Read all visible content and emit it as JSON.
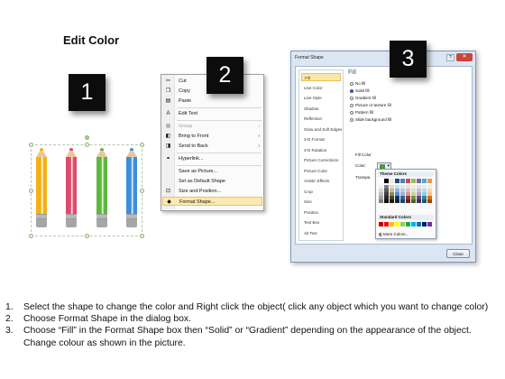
{
  "title": "Edit Color",
  "badges": [
    "1",
    "2",
    "3"
  ],
  "pencils": [
    {
      "name": "yellow",
      "color": "#f2b213"
    },
    {
      "name": "red",
      "color": "#e04a6a"
    },
    {
      "name": "green",
      "color": "#5cb83e"
    },
    {
      "name": "blue",
      "color": "#3a8fdc"
    }
  ],
  "context_menu": {
    "items": [
      {
        "label": "Cut",
        "icon": "scissors-icon",
        "glyph": "✂"
      },
      {
        "label": "Copy",
        "icon": "copy-icon",
        "glyph": "❐"
      },
      {
        "label": "Paste",
        "icon": "paste-icon",
        "glyph": "▤"
      },
      {
        "label": "Edit Text",
        "icon": "edit-text-icon",
        "glyph": "A"
      },
      {
        "label": "Group",
        "icon": "group-icon",
        "glyph": "▦",
        "disabled": true,
        "submenu": true
      },
      {
        "label": "Bring to Front",
        "icon": "bring-front-icon",
        "glyph": "◧",
        "submenu": true
      },
      {
        "label": "Send to Back",
        "icon": "send-back-icon",
        "glyph": "◨",
        "submenu": true
      },
      {
        "label": "Hyperlink...",
        "icon": "hyperlink-icon",
        "glyph": "⚭"
      },
      {
        "label": "Save as Picture...",
        "icon": "",
        "glyph": ""
      },
      {
        "label": "Set as Default Shape",
        "icon": "",
        "glyph": ""
      },
      {
        "label": "Size and Position...",
        "icon": "size-icon",
        "glyph": "⊡"
      },
      {
        "label": "Format Shape...",
        "icon": "format-shape-icon",
        "glyph": "◆",
        "highlight": true
      }
    ]
  },
  "dialog": {
    "title": "Format Shape",
    "close_label": "✕",
    "help_label": "?",
    "nav": [
      "Fill",
      "Line Color",
      "Line Style",
      "Shadow",
      "Reflection",
      "Glow and Soft Edges",
      "3-D Format",
      "3-D Rotation",
      "Picture Corrections",
      "Picture Color",
      "Artistic Effects",
      "Crop",
      "Size",
      "Position",
      "Text Box",
      "Alt Text"
    ],
    "selected_nav": "Fill",
    "pane_heading": "Fill",
    "fill_options": [
      {
        "label": "No fill",
        "checked": false
      },
      {
        "label": "Solid fill",
        "checked": true
      },
      {
        "label": "Gradient fill",
        "checked": false
      },
      {
        "label": "Picture or texture fill",
        "checked": false
      },
      {
        "label": "Pattern fill",
        "checked": false
      },
      {
        "label": "Slide background fill",
        "checked": false
      }
    ],
    "fill_color_label": "Fill Color",
    "color_label": "Color:",
    "transparency_label": "Transpa",
    "theme_colors_label": "Theme Colors",
    "standard_colors_label": "Standard Colors",
    "more_colors_label": "More Colors...",
    "close_button": "Close"
  },
  "palette": {
    "theme_top": [
      "#ffffff",
      "#000000",
      "#eeece1",
      "#1f497d",
      "#4f81bd",
      "#c0504d",
      "#9bbb59",
      "#8064a2",
      "#4bacc6",
      "#f79646"
    ],
    "theme_shades": [
      [
        "#f2f2f2",
        "#7f7f7f",
        "#ddd9c3",
        "#c6d9f0",
        "#dbe5f1",
        "#f2dcdb",
        "#ebf1dd",
        "#e5e0ec",
        "#dbeef3",
        "#fdeada"
      ],
      [
        "#d8d8d8",
        "#595959",
        "#c4bd97",
        "#8db3e2",
        "#b8cce4",
        "#e5b9b7",
        "#d7e3bc",
        "#ccc1d9",
        "#b7dde8",
        "#fbd5b5"
      ],
      [
        "#bfbfbf",
        "#3f3f3f",
        "#938953",
        "#548dd4",
        "#95b3d7",
        "#d99694",
        "#c3d69b",
        "#b2a2c7",
        "#92cddc",
        "#fac08f"
      ],
      [
        "#a5a5a5",
        "#262626",
        "#494429",
        "#17365d",
        "#366092",
        "#953734",
        "#76923c",
        "#5f497a",
        "#31859b",
        "#e36c09"
      ],
      [
        "#7f7f7f",
        "#0c0c0c",
        "#1d1b10",
        "#0f243e",
        "#244061",
        "#632423",
        "#4f6128",
        "#3f3151",
        "#205867",
        "#974806"
      ]
    ],
    "standard": [
      "#c00000",
      "#ff0000",
      "#ffc000",
      "#ffff00",
      "#92d050",
      "#00b050",
      "#00b0f0",
      "#0070c0",
      "#002060",
      "#7030a0"
    ]
  },
  "instructions": [
    {
      "num": "1.",
      "text": "Select the shape to change the color and Right click the object( click any object which you want to change color)"
    },
    {
      "num": "2.",
      "text": "Choose Format Shape in the dialog box."
    },
    {
      "num": "3.",
      "text": "Choose “Fill” in the Format Shape box then “Solid” or “Gradient” depending on the appearance of the object. Change colour as shown in the picture."
    }
  ]
}
